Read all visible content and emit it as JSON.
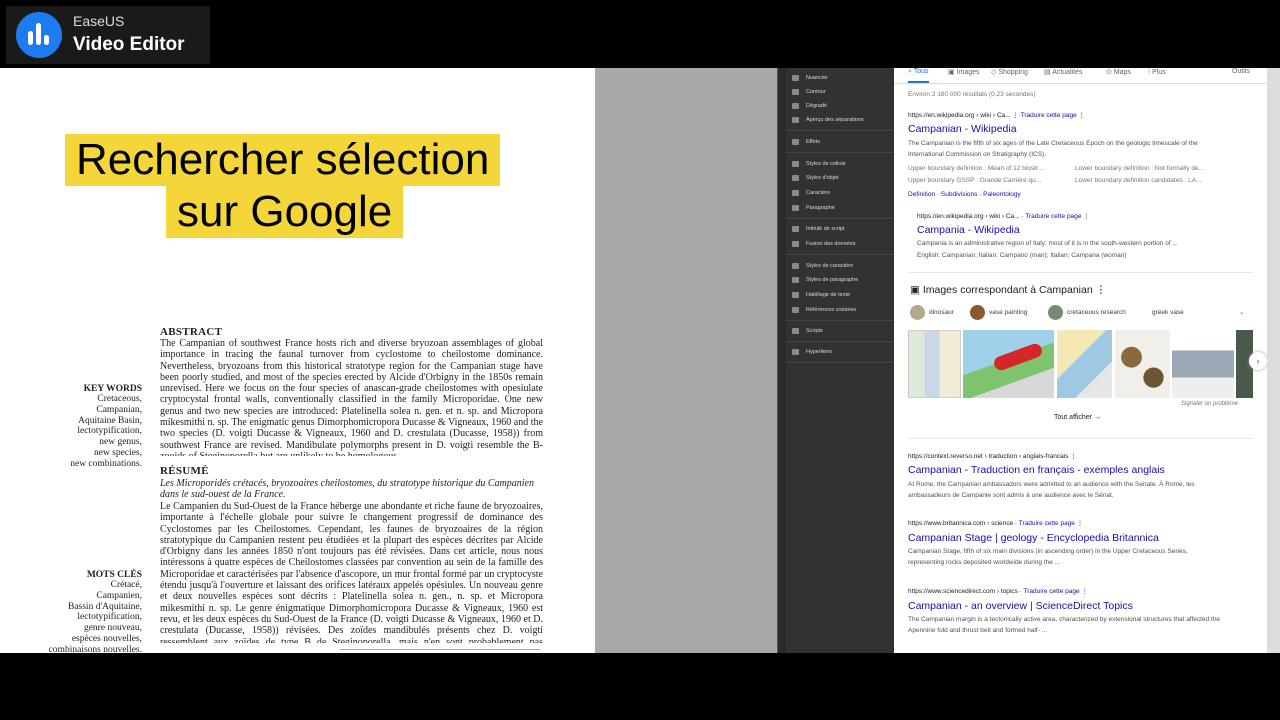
{
  "app": {
    "brand": "EaseUS",
    "product": "Video Editor"
  },
  "caption": {
    "line1": "Rechercher sélection",
    "line2": "sur Google"
  },
  "document": {
    "abstract_heading": "ABSTRACT",
    "abstract_text": "The Campanian of southwest France hosts rich and diverse bryozoan assemblages of global importance in tracing the faunal turnover from cyclostome to cheilostome dominance. Nevertheless, bryozoans from this historical stratotype region for the Campanian stage have been poorly studied, and most of the species erected by Alcide d'Orbigny in the 1850s remain unrevised. Here we focus on the four species of anascan-grade cheilostomes with opesiulate cryptocystal frontal walls, conventionally classified in the family Microporidae. One new genus and two new species are introduced: Platelinella solea n. gen. et n. sp. and Micropora mikesmithi n. sp. The enigmatic genus Dimorphomicropora Ducasse & Vigneaux, 1960 and the two species (D. voigti Ducasse & Vigneaux, 1960 and D. crestulata (Ducasse, 1958)) from southwest France are revised. Mandibulate polymorphs present in D. voigti resemble the B-zooids of Steginoporella but are unlikely to be homologous.",
    "keywords_heading": "KEY WORDS",
    "keywords": "Cretaceous,\nCampanian,\nAquitaine Basin,\nlectotypification,\nnew genus,\nnew species,\nnew combinations.",
    "resume_heading": "RÉSUMÉ",
    "resume_subtitle": "Les Microporidés crétacés, bryozoaires cheilostomes, du stratotype historique du Campanien dans le sud-ouest de la France.",
    "resume_text": "Le Campanien du Sud-Ouest de la France héberge une abondante et riche faune de bryozoaires, importante à l'échelle globale pour suivre le changement progressif de dominance des Cyclostomes par les Cheilostomes. Cependant, les faunes de bryozoaires de la région stratotypique du Campanien restent peu étudiées et la plupart des espèces décrites par Alcide d'Orbigny dans les années 1850 n'ont toujours pas été révisées. Dans cet article, nous nous intéressons à quatre espèces de Cheilostomes classées par convention au sein de la famille des Microporidae et caractérisées par l'absence d'ascopore, un mur frontal formé par un cryptocyste étendu jusqu'à l'ouverture et laissant des orifices latéraux appelés opésiules. Un nouveau genre et deux nouvelles espèces sont décrits : Platelinella solea n. gen., n. sp. et Micropora mikesmithi n. sp. Le genre énigmatique Dimorphomicropora Ducasse & Vigneaux, 1960 est revu, et les deux espèces du Sud-Ouest de la France (D. voigti Ducasse & Vigneaux, 1960 et D. crestulata (Ducasse, 1958)) révisées. Des zoïdes mandibulés présents chez D. voigti ressemblent aux zoïdes de type B de Steginoporella, mais n'en sont probablement pas homologues.",
    "motscles_heading": "MOTS CLÉS",
    "motscles": "Crétacé,\nCampanien,\nBassin d'Aquitaine,\nlectotypification,\ngenre nouveau,\nespèces nouvelles,\ncombinaisons nouvelles."
  },
  "panel": {
    "items": [
      "Nuancier",
      "Contour",
      "Dégradé",
      "Aperçu des séparations",
      "Effets",
      "Styles de cellule",
      "Styles d'objet",
      "Caractère",
      "Paragraphe",
      "Intitulé de script",
      "Fusion des données",
      "Styles de caractère",
      "Styles de paragraphe",
      "Habillage de texte",
      "Références croisées",
      "Scripts",
      "Hyperliens"
    ]
  },
  "google": {
    "tabs": [
      "Tous",
      "Images",
      "Shopping",
      "Actualités",
      "Maps",
      "Plus",
      "Outils"
    ],
    "result_count": "Environ 2 160 000 résultats (0,23 secondes)",
    "translate_label": "Traduire cette page",
    "results": [
      {
        "source": "https://en.wikipedia.org › wiki › Ca...",
        "title": "Campanian - Wikipedia",
        "snippet": "The Campanian is the fifth of six ages of the Late Cretaceous Epoch on the geologic timescale of the International Commission on Stratigraphy (ICS).",
        "facts": [
          "Upper boundary definition : Mean of 12 biostr...",
          "Lower boundary definition : Not formally de...",
          "Upper boundary GSSP : Grande Carrière qu...",
          "Lower boundary definition candidates : LA..."
        ],
        "links": [
          "Definition",
          "Subdivisions",
          "Paleontology"
        ]
      },
      {
        "source": "https://en.wikipedia.org › wiki › Ca...",
        "title": "Campania - Wikipedia",
        "snippet": "Campania is an administrative region of Italy; most of it is in the south-western portion of ...",
        "snippet2": "English: Campanian; Italian: Campano (man); Italian: Campana (woman)"
      },
      {
        "source": "https://context.reverso.net › traduction › anglais-francais",
        "title": "Campanian - Traduction en français - exemples anglais",
        "snippet": "At Rome, the Campanian ambassadors were admitted to an audience with the Senate. À Rome, les ambassadeurs de Campanie sont admis à une audience avec le Sénat."
      },
      {
        "source": "https://www.britannica.com › science",
        "title": "Campanian Stage | geology - Encyclopedia Britannica",
        "snippet": "Campanian Stage, fifth of six main divisions (in ascending order) in the Upper Cretaceous Series, representing rocks deposited worldwide during the ..."
      },
      {
        "source": "https://www.sciencedirect.com › topics",
        "title": "Campanian - an overview | ScienceDirect Topics",
        "snippet": "The Campanian margin is a tectonically active area, characterized by extensional structures that affected the Apennine fold and thrust belt and formed half- ..."
      }
    ],
    "images_heading": "Images correspondant à Campanian",
    "image_chips": [
      "dinosaur",
      "vase painting",
      "cretaceous research",
      "greek vase"
    ],
    "report_link": "Signaler un problème",
    "show_all": "Tout afficher"
  },
  "colors": {
    "caption_bg": "#f5d63a",
    "link": "#1a0dab",
    "accent": "#1a73e8",
    "panel_bg": "#323232"
  }
}
